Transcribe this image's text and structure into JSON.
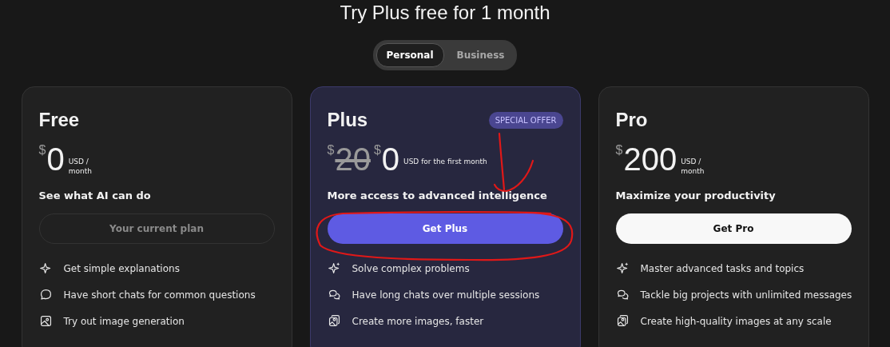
{
  "title": "Try Plus free for 1 month",
  "toggle": [
    {
      "label": "Personal",
      "selected": true
    },
    {
      "label": "Business",
      "selected": false
    }
  ],
  "plans": [
    {
      "kind": "free",
      "name": "Free",
      "currency": "$",
      "price": "0",
      "period": "USD /\nmonth",
      "tagline": "See what AI can do",
      "button": {
        "label": "Your current plan",
        "kind": "current"
      },
      "features": [
        "Get simple explanations",
        "Have short chats for common questions",
        "Try out image generation"
      ]
    },
    {
      "kind": "plus",
      "name": "Plus",
      "badge": "SPECIAL OFFER",
      "old_currency": "$",
      "old_price": "20",
      "currency": "$",
      "price": "0",
      "period": "USD for the first month",
      "tagline": "More access to advanced intelligence",
      "button": {
        "label": "Get Plus",
        "kind": "primary"
      },
      "features": [
        "Solve complex problems",
        "Have long chats over multiple sessions",
        "Create more images, faster"
      ]
    },
    {
      "kind": "pro",
      "name": "Pro",
      "currency": "$",
      "price": "200",
      "period": "USD /\nmonth",
      "tagline": "Maximize your productivity",
      "button": {
        "label": "Get Pro",
        "kind": "light"
      },
      "features": [
        "Master advanced tasks and topics",
        "Tackle big projects with unlimited messages",
        "Create high-quality images at any scale"
      ]
    }
  ]
}
